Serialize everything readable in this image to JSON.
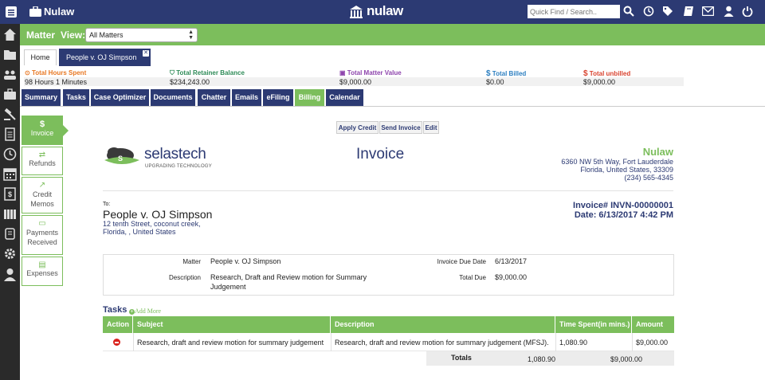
{
  "app": {
    "name": "Nulaw",
    "logo_text": "nulaw"
  },
  "header": {
    "search_placeholder": "Quick Find / Search..",
    "icons": [
      "search-icon",
      "clock-icon",
      "tags-icon",
      "book-icon",
      "mail-icon",
      "user-icon",
      "power-icon"
    ]
  },
  "sidebar_icons": [
    "home-icon",
    "folder-icon",
    "people-icon",
    "briefcase-icon",
    "gavel-icon",
    "document-icon",
    "clock-icon",
    "calendar-icon",
    "billing-icon",
    "library-icon",
    "scroll-icon",
    "settings-icon",
    "user-admin-icon"
  ],
  "subheader": {
    "matter_label": "Matter",
    "view_label": "View:",
    "view_selected": "All Matters"
  },
  "tabs": {
    "home": "Home",
    "matter": "People v. OJ Simpson"
  },
  "stats": [
    {
      "label": "Total Hours Spent",
      "value": "98 Hours 1 Minutes",
      "color": "#e87722",
      "icon": "clock-icon"
    },
    {
      "label": "Total Retainer Balance",
      "value": "$234,243.00",
      "color": "#2e8b57",
      "icon": "shield-icon"
    },
    {
      "label": "Total Matter Value",
      "value": "$9,000.00",
      "color": "#8e44ad",
      "icon": "money-icon"
    },
    {
      "label": "Total Billed",
      "value": "$0.00",
      "color": "#2c7fc1",
      "icon": "dollar-icon"
    },
    {
      "label": "Total unbilled",
      "value": "$9,000.00",
      "color": "#d9432f",
      "icon": "dollar-icon"
    }
  ],
  "nav_tabs": [
    "Summary",
    "Tasks",
    "Case Optimizer",
    "Documents",
    "Chatter",
    "Emails",
    "eFiling",
    "Billing",
    "Calendar"
  ],
  "active_tab": "Billing",
  "left_menu": [
    {
      "icon": "$",
      "label": "Invoice"
    },
    {
      "icon": "⇄",
      "label": "Refunds"
    },
    {
      "icon": "↗",
      "label": "Credit Memos"
    },
    {
      "icon": "▭",
      "label": "Payments Received"
    },
    {
      "icon": "▤",
      "label": "Expenses"
    }
  ],
  "actions": {
    "apply_credit": "Apply Credit",
    "send_invoice": "Send Invoice",
    "edit": "Edit"
  },
  "invoice": {
    "title": "Invoice",
    "logo_name": "selastech",
    "logo_tagline": "UPGRADING TECHNOLOGY",
    "firm": {
      "name": "Nulaw",
      "address1": "6360 NW 5th Way, Fort Lauderdale",
      "address2": "Florida, United States, 33309",
      "phone": "(234) 565-4345"
    },
    "to_label": "To:",
    "to_name": "People v. OJ Simpson",
    "to_address1": "12 tenth Street, coconut creek,",
    "to_address2": "Florida, , United States",
    "number_line": "Invoice# INVN-00000001",
    "date_line": "Date: 6/13/2017 4:42 PM"
  },
  "details": {
    "matter_label": "Matter",
    "matter_value": "People v. OJ Simpson",
    "description_label": "Description",
    "description_line1": "Research, Draft and Review motion for Summary",
    "description_line2": "Judgement",
    "due_date_label": "Invoice Due Date",
    "due_date_value": "6/13/2017",
    "total_due_label": "Total Due",
    "total_due_value": "$9,000.00"
  },
  "tasks": {
    "heading": "Tasks",
    "add_more": "Add More",
    "columns": [
      "Action",
      "Subject",
      "Description",
      "Time Spent(in mins.)",
      "Amount"
    ],
    "rows": [
      {
        "subject": "Research, draft and review motion for summary judgement",
        "description": "Research, draft and review motion for summary judgement (MFSJ).",
        "time": "1,080.90",
        "amount": "$9,000.00"
      }
    ],
    "totals_label": "Totals",
    "totals_time": "1,080.90",
    "totals_amount": "$9,000.00"
  },
  "colors": {
    "navy": "#2c3a73",
    "green": "#7cbe5c"
  }
}
